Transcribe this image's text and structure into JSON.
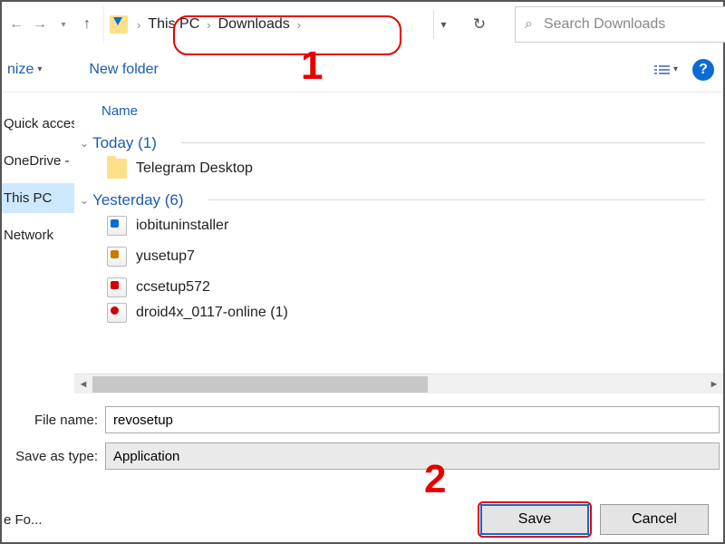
{
  "breadcrumb": {
    "seg1": "This PC",
    "seg2": "Downloads"
  },
  "search": {
    "placeholder": "Search Downloads"
  },
  "toolbar": {
    "organize": "nize",
    "newfolder": "New folder"
  },
  "sidebar": {
    "quick": "Quick acces",
    "onedrive": "OneDrive -",
    "thispc": "This PC",
    "network": "Network"
  },
  "columns": {
    "name": "Name"
  },
  "groups": {
    "today": {
      "label": "Today (1)",
      "items": [
        {
          "name": "Telegram Desktop"
        }
      ]
    },
    "yesterday": {
      "label": "Yesterday (6)",
      "items": [
        {
          "name": "iobituninstaller"
        },
        {
          "name": "yusetup7"
        },
        {
          "name": "ccsetup572"
        },
        {
          "name": "droid4x_0117-online (1)"
        }
      ]
    }
  },
  "form": {
    "filename_label": "File name:",
    "filename_value": "revosetup",
    "type_label": "Save as type:",
    "type_value": "Application",
    "hide": "e Fo...",
    "save": "Save",
    "cancel": "Cancel"
  },
  "annot": {
    "a1": "1",
    "a2": "2"
  }
}
